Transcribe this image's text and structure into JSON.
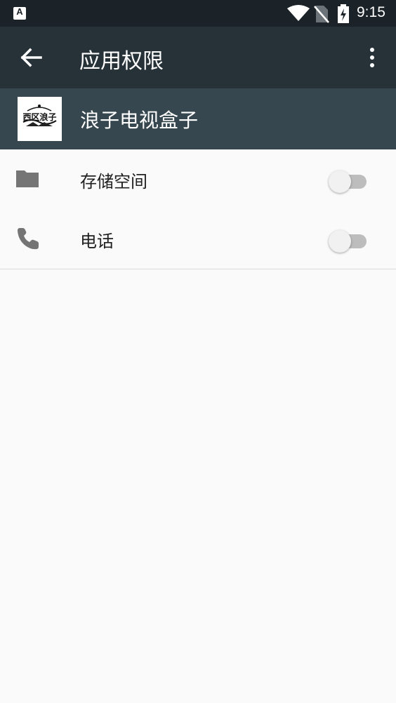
{
  "status_bar": {
    "app_notification_icon": "font-icon",
    "time": "9:15"
  },
  "toolbar": {
    "title": "应用权限",
    "back_icon": "arrow-back-icon",
    "menu_icon": "more-vert-icon"
  },
  "app": {
    "name": "浪子电视盒子",
    "icon_text": "西区浪子"
  },
  "permissions": [
    {
      "label": "存储空间",
      "icon": "folder-icon",
      "enabled": false
    },
    {
      "label": "电话",
      "icon": "phone-icon",
      "enabled": false
    }
  ],
  "colors": {
    "status_bar": "#1b2328",
    "toolbar": "#263238",
    "app_header": "#37474f",
    "background": "#fafafa",
    "switch_off_track": "#bdbdbd"
  }
}
